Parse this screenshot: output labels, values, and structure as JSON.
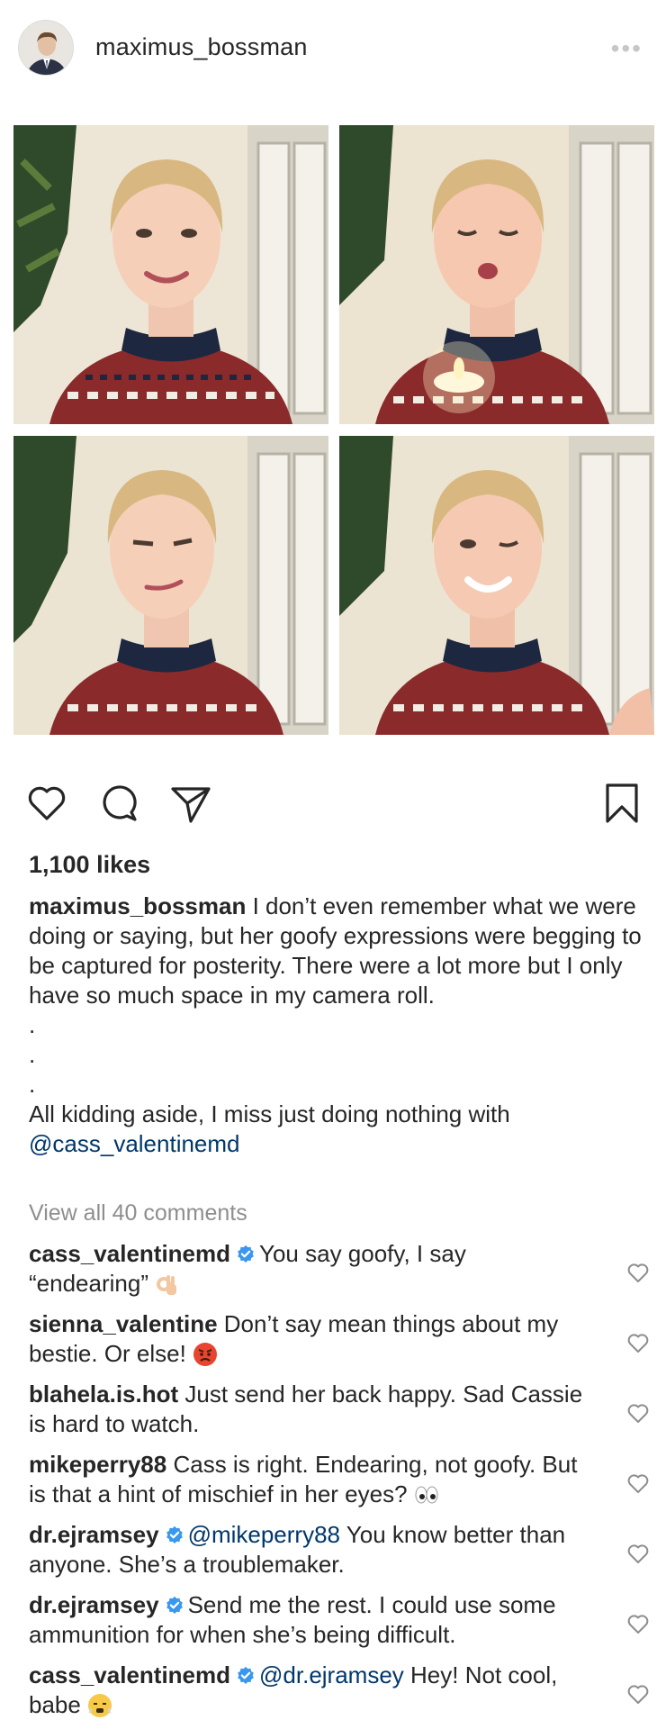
{
  "post": {
    "username": "maximus_bossman",
    "more_label": "•••",
    "likes": "1,100 likes",
    "caption": {
      "username": "maximus_bossman",
      "text": "I don’t even remember what we were doing or saying, but her goofy expressions were begging to be captured for posterity. There were a lot more but I only have so much space in my camera roll.",
      "dots": [
        ".",
        ".",
        "."
      ],
      "closing": "All kidding aside, I miss just doing nothing with",
      "mention": "@cass_valentinemd"
    },
    "view_all": "View all 40 comments"
  },
  "comments": [
    {
      "user": "cass_valentinemd",
      "verified": true,
      "mention": "",
      "text": "You say goofy, I say “endearing”",
      "emoji": "ok-hand"
    },
    {
      "user": "sienna_valentine",
      "verified": false,
      "mention": "",
      "text": "Don’t say mean things about my bestie. Or else!",
      "emoji": "angry-face"
    },
    {
      "user": "blahela.is.hot",
      "verified": false,
      "mention": "",
      "text": "Just send her back happy. Sad Cassie is hard to watch.",
      "emoji": ""
    },
    {
      "user": "mikeperry88",
      "verified": false,
      "mention": "",
      "text": "Cass is right. Endearing, not goofy. But is that a hint of mischief in her eyes?",
      "emoji": "eyes"
    },
    {
      "user": "dr.ejramsey",
      "verified": true,
      "mention": "@mikeperry88",
      "text": " You know better than anyone. She’s a troublemaker.",
      "emoji": ""
    },
    {
      "user": "dr.ejramsey",
      "verified": true,
      "mention": "",
      "text": "Send me the rest. I could use some ammunition for when she’s being difficult.",
      "emoji": ""
    },
    {
      "user": "cass_valentinemd",
      "verified": true,
      "mention": "@dr.ejramsey",
      "text": "Hey! Not cool, babe",
      "emoji": "huffing-face"
    }
  ],
  "colors": {
    "text": "#262626",
    "muted": "#8e8e8e",
    "mention": "#00376b",
    "verified": "#3897f0",
    "sweater_red": "#8a2a2a",
    "sweater_navy": "#1e2740"
  },
  "icons": [
    "heart-icon",
    "comment-icon",
    "share-icon",
    "bookmark-icon",
    "verified-icon",
    "more-icon"
  ]
}
